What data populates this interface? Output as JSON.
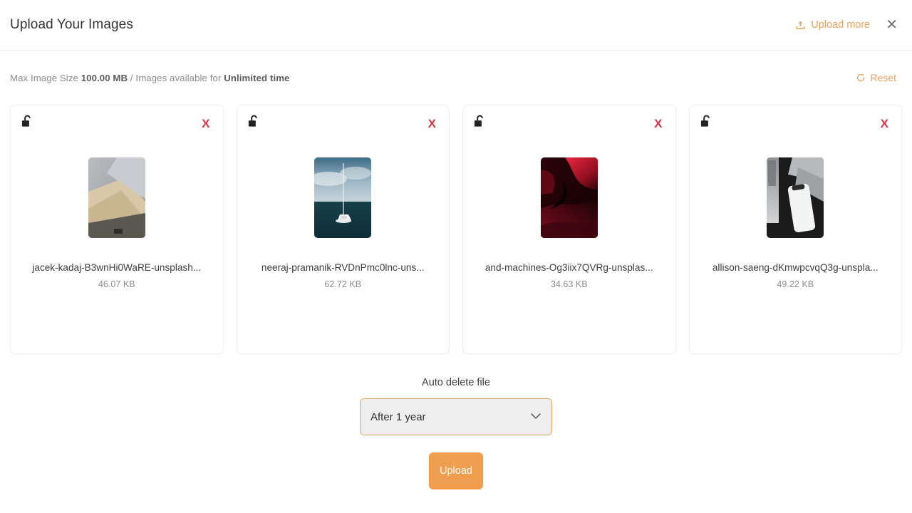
{
  "header": {
    "title": "Upload Your Images",
    "upload_more_label": "Upload more",
    "upload_more_icon": "upload-icon",
    "close_icon": "close-icon",
    "close_glyph": "✕"
  },
  "infobar": {
    "prefix": "Max Image Size ",
    "max_size": "100.00 MB",
    "middle": " / Images available for ",
    "availability": "Unlimited time",
    "reset_label": "Reset",
    "reset_icon": "refresh-icon"
  },
  "cards": [
    {
      "lock_icon": "unlocked-padlock-icon",
      "remove_icon": "remove-x-icon",
      "remove_glyph": "X",
      "thumbnail": "concrete-paper-abstract-thumbnail",
      "filename": "jacek-kadaj-B3wnHi0WaRE-unsplash...",
      "filesize": "46.07 KB"
    },
    {
      "lock_icon": "unlocked-padlock-icon",
      "remove_icon": "remove-x-icon",
      "remove_glyph": "X",
      "thumbnail": "sailboat-on-sea-thumbnail",
      "filename": "neeraj-pramanik-RVDnPmc0lnc-uns...",
      "filesize": "62.72 KB"
    },
    {
      "lock_icon": "unlocked-padlock-icon",
      "remove_icon": "remove-x-icon",
      "remove_glyph": "X",
      "thumbnail": "red-dark-gradient-thumbnail",
      "filename": "and-machines-Og3iix7QVRg-unsplas...",
      "filesize": "34.63 KB"
    },
    {
      "lock_icon": "unlocked-padlock-icon",
      "remove_icon": "remove-x-icon",
      "remove_glyph": "X",
      "thumbnail": "grayscale-phone-thumbnail",
      "filename": "allison-saeng-dKmwpcvqQ3g-unspla...",
      "filesize": "49.22 KB"
    }
  ],
  "footer": {
    "auto_delete_label": "Auto delete file",
    "auto_delete_value": "After 1 year",
    "caret_icon": "chevron-down-icon",
    "upload_button_label": "Upload"
  },
  "colors": {
    "accent_orange": "#ee9e4e",
    "link_orange": "#e8a25c",
    "remove_red": "#dc3545",
    "card_border": "#eeeeee",
    "select_bg": "#eeeeee",
    "select_border": "#e5a561"
  }
}
